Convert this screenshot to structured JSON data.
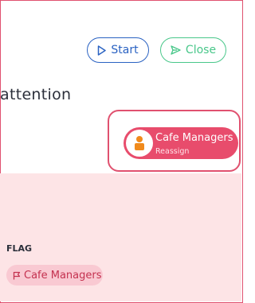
{
  "toolbar": {
    "start_label": "Start",
    "close_label": "Close"
  },
  "heading": "attention",
  "assignment": {
    "name": "Cafe Managers",
    "action": "Reassign"
  },
  "flag": {
    "label": "FLAG",
    "value": "Cafe Managers"
  },
  "colors": {
    "accent_pink": "#e84c6c",
    "start_blue": "#2a62c2",
    "close_green": "#49c78a",
    "panel_bg": "#fde4e6"
  },
  "icons": {
    "start": "play-icon",
    "close": "send-icon",
    "avatar": "person-icon",
    "flag": "flag-icon"
  }
}
